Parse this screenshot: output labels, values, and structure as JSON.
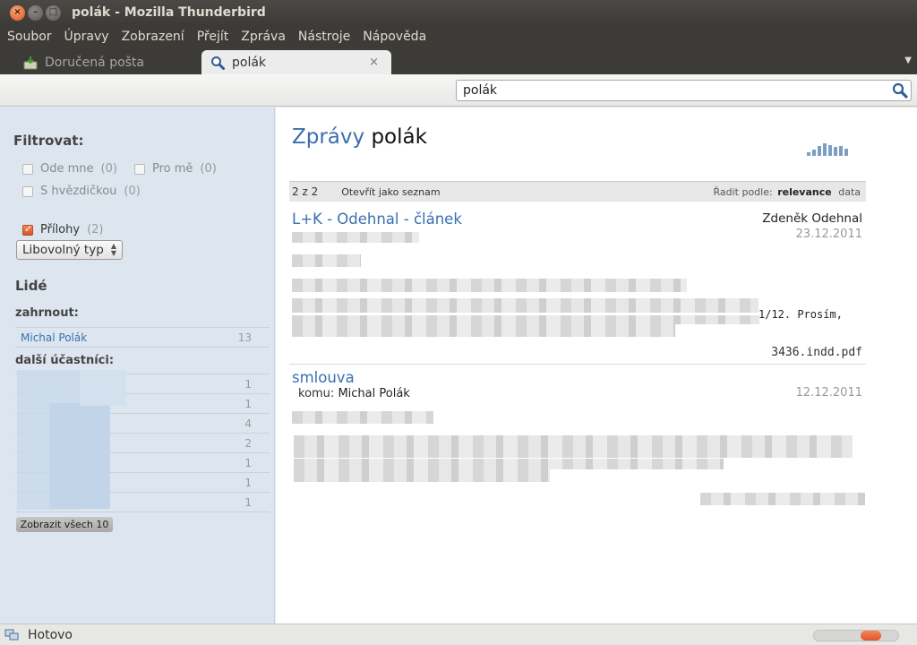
{
  "window": {
    "title": "polák - Mozilla Thunderbird"
  },
  "menubar": [
    "Soubor",
    "Úpravy",
    "Zobrazení",
    "Přejít",
    "Zpráva",
    "Nástroje",
    "Nápověda"
  ],
  "tabs": [
    {
      "label": "Doručená pošta",
      "icon": "inbox-icon"
    },
    {
      "label": "polák",
      "icon": "search-icon",
      "close": "×"
    }
  ],
  "search": {
    "value": "polák"
  },
  "sidebar": {
    "filter_title": "Filtrovat:",
    "filters": {
      "from_me": {
        "label": "Ode mne",
        "count": "(0)"
      },
      "to_me": {
        "label": "Pro mě",
        "count": "(0)"
      },
      "starred": {
        "label": "S hvězdičkou",
        "count": "(0)"
      },
      "attachments": {
        "label": "Přílohy",
        "count": "(2)",
        "checked": true
      }
    },
    "type_select": "Libovolný typ",
    "people_heading": "Lidé",
    "include_heading": "zahrnout:",
    "include_people": [
      {
        "name": "Michal Polák",
        "count": "13"
      }
    ],
    "others_heading": "další účastníci:",
    "other_counts": [
      "1",
      "1",
      "4",
      "2",
      "1",
      "1",
      "1"
    ],
    "show_all": "Zobrazit všech 10"
  },
  "results": {
    "heading_prefix": "Zprávy",
    "heading_query": "polák",
    "count_label": "2 z 2",
    "open_as_list": "Otevřít jako seznam",
    "sort_label": "Řadit podle:",
    "sort_relevance": "relevance",
    "sort_date": "data",
    "messages": [
      {
        "title": "L+K - Odehnal - článek",
        "from": "Zdeněk Odehnal",
        "date": "23.12.2011",
        "snippet_tail": "1/12. Prosím,",
        "attachment": "3436.indd.pdf"
      },
      {
        "title": "smlouva",
        "to_label": "komu:",
        "to": "Michal Polák",
        "date": "12.12.2011"
      }
    ]
  },
  "status": {
    "text": "Hotovo",
    "progress": 0.25
  },
  "colors": {
    "accent": "#3a6fb0",
    "sidebar": "#dde6ef",
    "titlebar": "#3c3b37",
    "orange": "#e0552a"
  }
}
